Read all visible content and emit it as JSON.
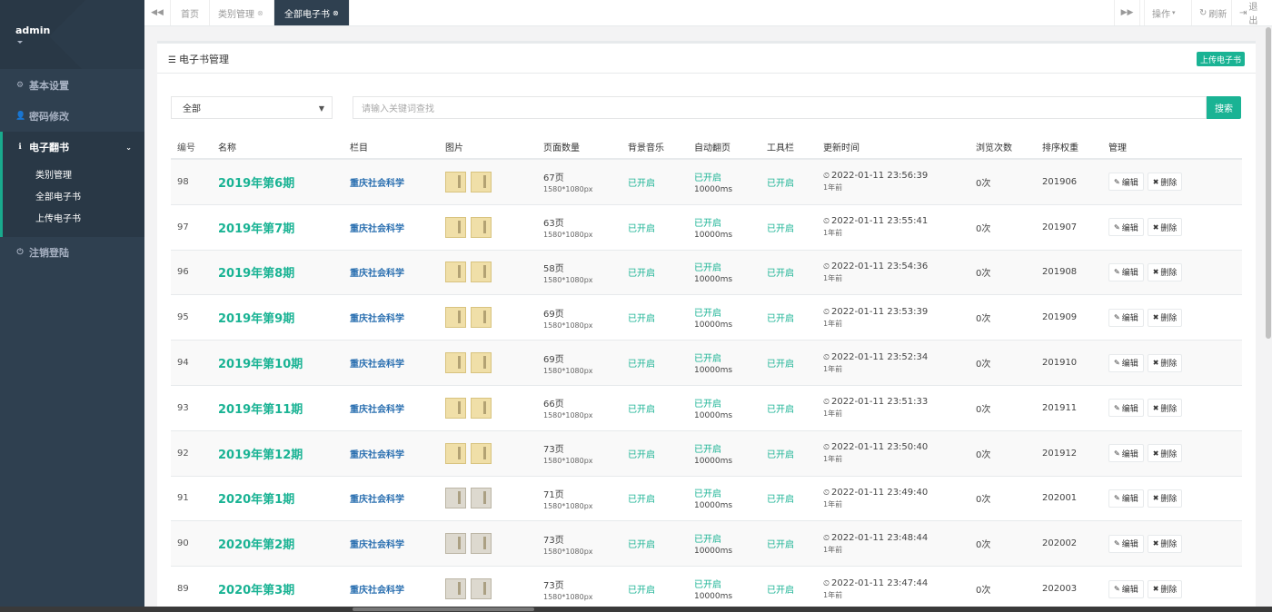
{
  "sidebar": {
    "username": "admin",
    "items": [
      {
        "label": "基本设置",
        "icon": "gear-icon",
        "glyph": "⚙"
      },
      {
        "label": "密码修改",
        "icon": "user-icon",
        "glyph": "👤"
      }
    ],
    "group": {
      "label": "电子翻书",
      "icon": "info-icon",
      "glyph": "ℹ",
      "subs": [
        "类别管理",
        "全部电子书",
        "上传电子书"
      ]
    },
    "logout": {
      "label": "注销登陆",
      "icon": "power-icon",
      "glyph": "⏻"
    }
  },
  "tabs": [
    {
      "label": "首页",
      "closable": false
    },
    {
      "label": "类别管理",
      "closable": true
    },
    {
      "label": "全部电子书",
      "closable": true
    }
  ],
  "tools": {
    "ops": "操作",
    "refresh": "刷新",
    "exit": "退出"
  },
  "box": {
    "title": "电子书管理",
    "upload": "上传电子书"
  },
  "filter": {
    "select_value": "全部",
    "search_placeholder": "请输入关键词查找",
    "search_button": "搜索"
  },
  "table": {
    "headers": [
      "编号",
      "名称",
      "栏目",
      "图片",
      "页面数量",
      "背景音乐",
      "自动翻页",
      "工具栏",
      "更新时间",
      "浏览次数",
      "排序权重",
      "管理"
    ],
    "rows": [
      {
        "id": "98",
        "name": "2019年第6期",
        "cat": "重庆社会科学",
        "pages": "67页",
        "res": "1580*1080px",
        "bgm": "已开启",
        "auto": "已开启",
        "ms": "10000ms",
        "tool": "已开启",
        "time": "2022-01-11 23:56:39",
        "ago": "1年前",
        "views": "0次",
        "sort": "201906",
        "grey": false
      },
      {
        "id": "97",
        "name": "2019年第7期",
        "cat": "重庆社会科学",
        "pages": "63页",
        "res": "1580*1080px",
        "bgm": "已开启",
        "auto": "已开启",
        "ms": "10000ms",
        "tool": "已开启",
        "time": "2022-01-11 23:55:41",
        "ago": "1年前",
        "views": "0次",
        "sort": "201907",
        "grey": false
      },
      {
        "id": "96",
        "name": "2019年第8期",
        "cat": "重庆社会科学",
        "pages": "58页",
        "res": "1580*1080px",
        "bgm": "已开启",
        "auto": "已开启",
        "ms": "10000ms",
        "tool": "已开启",
        "time": "2022-01-11 23:54:36",
        "ago": "1年前",
        "views": "0次",
        "sort": "201908",
        "grey": false
      },
      {
        "id": "95",
        "name": "2019年第9期",
        "cat": "重庆社会科学",
        "pages": "69页",
        "res": "1580*1080px",
        "bgm": "已开启",
        "auto": "已开启",
        "ms": "10000ms",
        "tool": "已开启",
        "time": "2022-01-11 23:53:39",
        "ago": "1年前",
        "views": "0次",
        "sort": "201909",
        "grey": false
      },
      {
        "id": "94",
        "name": "2019年第10期",
        "cat": "重庆社会科学",
        "pages": "69页",
        "res": "1580*1080px",
        "bgm": "已开启",
        "auto": "已开启",
        "ms": "10000ms",
        "tool": "已开启",
        "time": "2022-01-11 23:52:34",
        "ago": "1年前",
        "views": "0次",
        "sort": "201910",
        "grey": false
      },
      {
        "id": "93",
        "name": "2019年第11期",
        "cat": "重庆社会科学",
        "pages": "66页",
        "res": "1580*1080px",
        "bgm": "已开启",
        "auto": "已开启",
        "ms": "10000ms",
        "tool": "已开启",
        "time": "2022-01-11 23:51:33",
        "ago": "1年前",
        "views": "0次",
        "sort": "201911",
        "grey": false
      },
      {
        "id": "92",
        "name": "2019年第12期",
        "cat": "重庆社会科学",
        "pages": "73页",
        "res": "1580*1080px",
        "bgm": "已开启",
        "auto": "已开启",
        "ms": "10000ms",
        "tool": "已开启",
        "time": "2022-01-11 23:50:40",
        "ago": "1年前",
        "views": "0次",
        "sort": "201912",
        "grey": false
      },
      {
        "id": "91",
        "name": "2020年第1期",
        "cat": "重庆社会科学",
        "pages": "71页",
        "res": "1580*1080px",
        "bgm": "已开启",
        "auto": "已开启",
        "ms": "10000ms",
        "tool": "已开启",
        "time": "2022-01-11 23:49:40",
        "ago": "1年前",
        "views": "0次",
        "sort": "202001",
        "grey": true
      },
      {
        "id": "90",
        "name": "2020年第2期",
        "cat": "重庆社会科学",
        "pages": "73页",
        "res": "1580*1080px",
        "bgm": "已开启",
        "auto": "已开启",
        "ms": "10000ms",
        "tool": "已开启",
        "time": "2022-01-11 23:48:44",
        "ago": "1年前",
        "views": "0次",
        "sort": "202002",
        "grey": true
      },
      {
        "id": "89",
        "name": "2020年第3期",
        "cat": "重庆社会科学",
        "pages": "73页",
        "res": "1580*1080px",
        "bgm": "已开启",
        "auto": "已开启",
        "ms": "10000ms",
        "tool": "已开启",
        "time": "2022-01-11 23:47:44",
        "ago": "1年前",
        "views": "0次",
        "sort": "202003",
        "grey": true
      }
    ],
    "edit_label": "编辑",
    "delete_label": "删除"
  },
  "colors": {
    "accent": "#1ab394",
    "sidebar": "#2f4050",
    "link": "#2a6fb0"
  }
}
